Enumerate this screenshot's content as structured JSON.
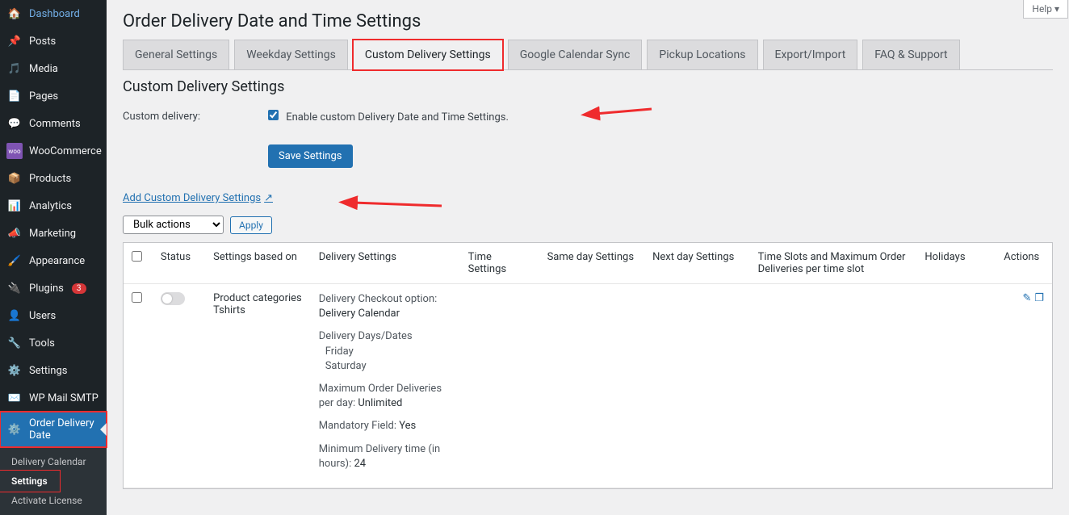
{
  "help": "Help ▾",
  "sidebar": {
    "items": [
      {
        "icon": "dash",
        "label": "Dashboard"
      },
      {
        "icon": "pin",
        "label": "Posts"
      },
      {
        "icon": "media",
        "label": "Media"
      },
      {
        "icon": "page",
        "label": "Pages"
      },
      {
        "icon": "comment",
        "label": "Comments"
      },
      {
        "icon": "woo",
        "label": "WooCommerce"
      },
      {
        "icon": "box",
        "label": "Products"
      },
      {
        "icon": "chart",
        "label": "Analytics"
      },
      {
        "icon": "horn",
        "label": "Marketing"
      },
      {
        "icon": "brush",
        "label": "Appearance"
      },
      {
        "icon": "plug",
        "label": "Plugins",
        "badge": "3"
      },
      {
        "icon": "user",
        "label": "Users"
      },
      {
        "icon": "wrench",
        "label": "Tools"
      },
      {
        "icon": "sliders",
        "label": "Settings"
      },
      {
        "icon": "mail",
        "label": "WP Mail SMTP"
      },
      {
        "icon": "gear",
        "label": "Order Delivery Date",
        "active": true
      }
    ],
    "sub": [
      "Delivery Calendar",
      "Settings",
      "Activate License"
    ],
    "sub_current": "Settings"
  },
  "page": {
    "title": "Order Delivery Date and Time Settings",
    "tabs": [
      "General Settings",
      "Weekday Settings",
      "Custom Delivery Settings",
      "Google Calendar Sync",
      "Pickup Locations",
      "Export/Import",
      "FAQ & Support"
    ],
    "active_tab": "Custom Delivery Settings",
    "section": "Custom Delivery Settings",
    "custom_label": "Custom delivery:",
    "enable_text": "Enable custom Delivery Date and Time Settings.",
    "save_btn": "Save Settings",
    "add_link": "Add Custom Delivery Settings",
    "bulk": "Bulk actions",
    "apply": "Apply"
  },
  "table": {
    "headers": {
      "status": "Status",
      "settings": "Settings based on",
      "ds": "Delivery Settings",
      "ts": "Time Settings",
      "sds": "Same day Settings",
      "nds": "Next day Settings",
      "slot": "Time Slots and Maximum Order Deliveries per time slot",
      "hol": "Holidays",
      "act": "Actions"
    },
    "row": {
      "settings_line1": "Product categories",
      "settings_line2": "Tshirts",
      "ds": {
        "checkout_h": "Delivery Checkout option:",
        "checkout_v": "Delivery Calendar",
        "days_h": "Delivery Days/Dates",
        "day1": "Friday",
        "day2": "Saturday",
        "max_h": "Maximum Order Deliveries per day:",
        "max_v": " Unlimited",
        "mand_h": "Mandatory Field:",
        "mand_v": " Yes",
        "min_h": "Minimum Delivery time (in hours):",
        "min_v": " 24"
      }
    }
  }
}
